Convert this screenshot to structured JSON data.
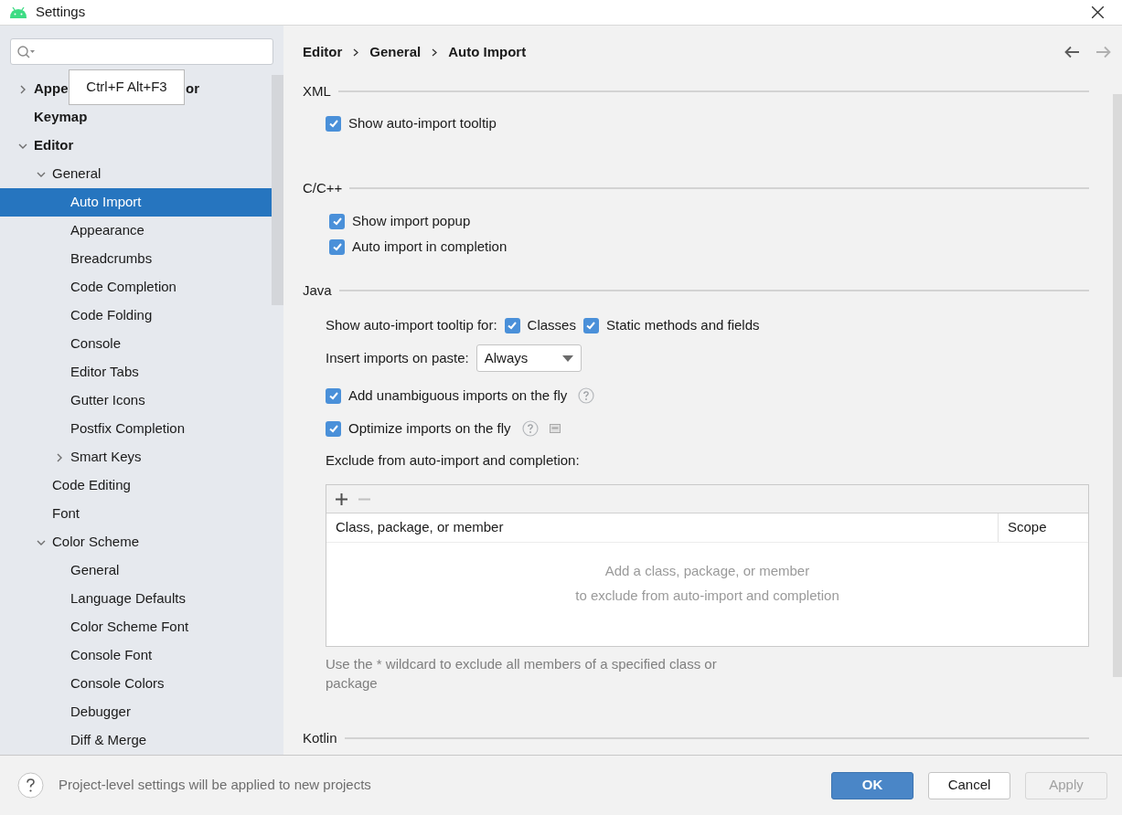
{
  "window": {
    "title": "Settings"
  },
  "tooltip": {
    "text": "Ctrl+F Alt+F3"
  },
  "tree": [
    {
      "label_start": "Appe",
      "label_end": "or",
      "expanded": false,
      "selected": false
    },
    {
      "label": "Keymap",
      "selected": false
    },
    {
      "label": "Editor",
      "expanded": true,
      "selected": false,
      "children": [
        {
          "label": "General",
          "expanded": true,
          "selected": false,
          "children": [
            {
              "label": "Auto Import",
              "selected": true
            },
            {
              "label": "Appearance",
              "selected": false
            },
            {
              "label": "Breadcrumbs",
              "selected": false
            },
            {
              "label": "Code Completion",
              "selected": false
            },
            {
              "label": "Code Folding",
              "selected": false
            },
            {
              "label": "Console",
              "selected": false
            },
            {
              "label": "Editor Tabs",
              "selected": false
            },
            {
              "label": "Gutter Icons",
              "selected": false
            },
            {
              "label": "Postfix Completion",
              "selected": false
            },
            {
              "label": "Smart Keys",
              "expanded": false,
              "selected": false
            }
          ]
        },
        {
          "label": "Code Editing",
          "selected": false
        },
        {
          "label": "Font",
          "selected": false
        },
        {
          "label": "Color Scheme",
          "expanded": true,
          "selected": false,
          "children": [
            {
              "label": "General",
              "selected": false
            },
            {
              "label": "Language Defaults",
              "selected": false
            },
            {
              "label": "Color Scheme Font",
              "selected": false
            },
            {
              "label": "Console Font",
              "selected": false
            },
            {
              "label": "Console Colors",
              "selected": false
            },
            {
              "label": "Debugger",
              "selected": false
            },
            {
              "label": "Diff & Merge",
              "selected": false
            }
          ]
        }
      ]
    }
  ],
  "breadcrumb": [
    "Editor",
    "General",
    "Auto Import"
  ],
  "nav": {
    "back_disabled": false,
    "forward_disabled": true
  },
  "sections": [
    {
      "title": "XML",
      "rows": [
        {
          "kind": "checkbox",
          "label": "Show auto-import tooltip",
          "checked": true
        }
      ]
    },
    {
      "title": "C/C++",
      "rows": [
        {
          "kind": "checkbox",
          "label": "Show import popup",
          "checked": true
        },
        {
          "kind": "checkbox",
          "label": "Auto import in completion",
          "checked": true
        }
      ]
    },
    {
      "title": "Java",
      "rows": [
        {
          "kind": "checkgroup",
          "label": "Show auto-import tooltip for:",
          "options": [
            {
              "label": "Classes",
              "checked": true
            },
            {
              "label": "Static methods and fields",
              "checked": true
            }
          ]
        },
        {
          "kind": "select",
          "label": "Insert imports on paste:",
          "value": "Always"
        },
        {
          "kind": "checkbox",
          "label": "Add unambiguous imports on the fly",
          "checked": true,
          "help": true
        },
        {
          "kind": "checkbox",
          "label": "Optimize imports on the fly",
          "checked": true,
          "help": true,
          "config": true
        },
        {
          "kind": "label",
          "label": "Exclude from auto-import and completion:"
        },
        {
          "kind": "table",
          "add_disabled": false,
          "remove_disabled": true,
          "columns": [
            "Class, package, or member",
            "Scope"
          ],
          "empty_text": [
            "Add a class, package, or member",
            "to exclude from auto-import and completion"
          ]
        },
        {
          "kind": "note",
          "text": "Use the * wildcard to exclude all members of a specified class or package"
        }
      ]
    },
    {
      "title": "Kotlin"
    }
  ],
  "footer": {
    "help_text": "Project-level settings will be applied to new projects",
    "buttons": [
      {
        "label": "OK",
        "kind": "primary"
      },
      {
        "label": "Cancel",
        "kind": "normal"
      },
      {
        "label": "Apply",
        "kind": "disabled"
      }
    ]
  }
}
